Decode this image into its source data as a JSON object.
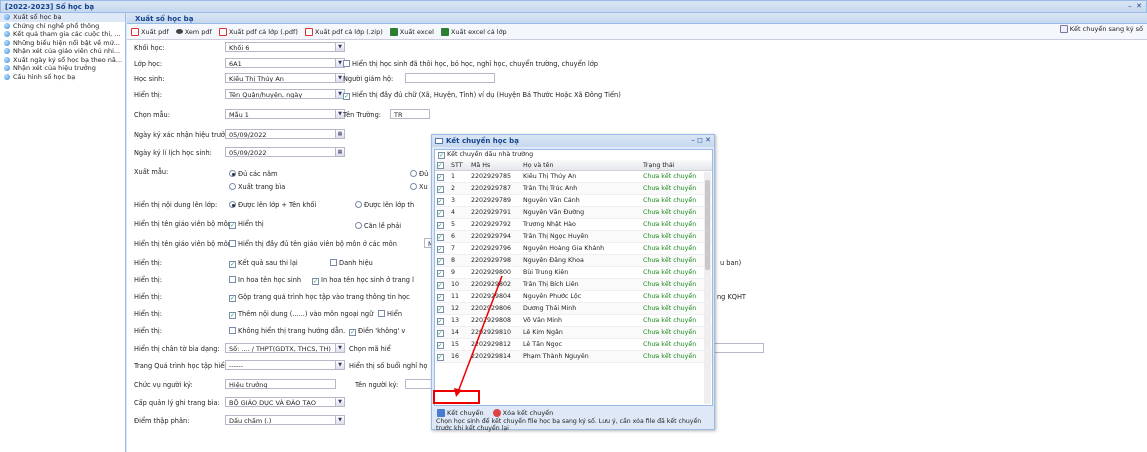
{
  "top_title": "[2022-2023] Sổ học bạ",
  "top_ctrls": "– ⁠ ✕",
  "tree": [
    "Xuất sổ học bạ",
    "Chứng chỉ nghề phổ thông",
    "Kết quả tham gia các cuộc thi, ...",
    "Những biểu hiện nổi bật về mứ...",
    "Nhận xét của giáo viên chủ nhi...",
    "Xuất ngày ký sổ học bạ theo nă...",
    "Nhận xét của hiệu trưởng",
    "Cấu hình sổ học bạ"
  ],
  "panel_title": "Xuất sổ học bạ",
  "toolbar": [
    "Xuất pdf",
    "Xem pdf",
    "Xuất pdf cả lớp (.pdf)",
    "Xuất pdf cả lớp (.zip)",
    "Xuất excel",
    "Xuất excel cả lớp"
  ],
  "toolbar_right": "Kết chuyển sang ký số",
  "form": {
    "khoi_label": "Khối học:",
    "khoi_val": "Khối 6",
    "lop_label": "Lớp học:",
    "lop_val": "6A1",
    "lop_cb": "Hiển thị học sinh đã thôi học, bỏ học, nghỉ học, chuyển trường, chuyển lớp",
    "hs_label": "Học sinh:",
    "hs_val": "Kiều Thị Thúy An",
    "gh_label": "Người giám hộ:",
    "ht_label": "Hiển thị:",
    "ht_val": "Tên Quận/huyện, ngày",
    "ht_cb": "Hiển thị đầy đủ chữ (Xã, Huyện, Tỉnh) ví dụ (Huyện Bá Thước Hoặc Xã Đông Tiến)",
    "mau_label": "Chọn mẫu:",
    "mau_val": "Mẫu 1",
    "tt_label": "Tên Trường:",
    "tt_val": "TR",
    "nky_label": "Ngày ký xác nhận hiệu trưởng:",
    "nky_val": "05/09/2022",
    "nll_label": "Ngày ký lí lịch học sinh:",
    "nll_val": "05/09/2022",
    "xm_label": "Xuất mẫu:",
    "xm_r1": "Đủ các năm",
    "xm_r2": "Xuất trang bìa",
    "xm_r3": "Đủ",
    "xm_r4": "Xu",
    "nd_label": "Hiển thị nội dung lên lớp:",
    "nd_r1": "Được lên lớp + Tên khối",
    "nd_r2": "Được lên lớp th",
    "gv_label": "Hiển thị tên giáo viên bộ môn:",
    "gv_cb": "Hiển thị",
    "gv_r": "Căn lề phải",
    "gvf_label": "Hiển thị tên giáo viên bộ môn:",
    "gvf_cb": "Hiển thị đầy đủ tên giáo viên bộ môn ở các môn",
    "gvf_val": "Mã",
    "h1_label": "Hiển thị:",
    "h1_cb": "Kết quả sau thi lại",
    "h1_cb2": "Danh hiệu",
    "h1_tail": "u ban)",
    "h2_label": "Hiển thị:",
    "h2_cb": "In hoa tên học sinh",
    "h2_cb2": "In hoa tên học sinh ở trang l",
    "h3_label": "Hiển thị:",
    "h3_cb": "Gộp trang quá trình học tập vào trang thông tin học",
    "h3_tail": "ng KQHT",
    "h4_label": "Hiển thị:",
    "h4_cb": "Thêm nội dung (......) vào môn ngoại ngữ",
    "h4_cb2": "Hiển",
    "h5_label": "Hiển thị:",
    "h5_cb": "Không hiển thị trang hướng dẫn.",
    "h5_cb2": "Điền 'không' v",
    "ct_label": "Hiển thị chân tờ bìa dạng:",
    "ct_val": "Số: .... / THPT(GDTX, THCS, TH)",
    "ct_label2": "Chọn mã hiể",
    "qt_label": "Trang Quá trình học tập hiển thị:",
    "qt_val": "------",
    "qt_label2": "Hiển thị số buổi nghỉ họ",
    "cv_label": "Chức vụ người ký:",
    "cv_val": "Hiệu trưởng",
    "tnk_label": "Tên người ký:",
    "cq_label": "Cấp quản lý ghi trang bìa:",
    "cq_val": "BỘ GIÁO DỤC VÀ ĐÀO TẠO",
    "dtp_label": "Điểm thập phân:",
    "dtp_val": "Dấu chấm (.)"
  },
  "win": {
    "title": "Kết chuyển học bạ",
    "ctrls": "– ◻ ✕",
    "top_cb": "Kết chuyển dấu nhà trường",
    "headers": [
      "STT",
      "Mã Hs",
      "Họ và tên",
      "Trạng thái"
    ],
    "rows": [
      [
        "1",
        "2202929785",
        "Kiều Thị Thúy An"
      ],
      [
        "2",
        "2202929787",
        "Trần Thị Trúc Anh"
      ],
      [
        "3",
        "2202929789",
        "Nguyễn Văn Cảnh"
      ],
      [
        "4",
        "2202929791",
        "Nguyễn Văn Đường"
      ],
      [
        "5",
        "2202929792",
        "Trương Nhật Hào"
      ],
      [
        "6",
        "2202929794",
        "Trần Thị Ngọc Huyền"
      ],
      [
        "7",
        "2202929796",
        "Nguyễn Hoàng Gia Khánh"
      ],
      [
        "8",
        "2202929798",
        "Nguyễn Đăng Khoa"
      ],
      [
        "9",
        "2202929800",
        "Bùi Trung Kiên"
      ],
      [
        "10",
        "2202929802",
        "Trần Thị Bích Liên"
      ],
      [
        "11",
        "2202929804",
        "Nguyễn Phước Lộc"
      ],
      [
        "12",
        "2202929806",
        "Dương Thái Minh"
      ],
      [
        "13",
        "2202929808",
        "Võ Văn Minh"
      ],
      [
        "14",
        "2202929810",
        "Lê Kim Ngân"
      ],
      [
        "15",
        "2202929812",
        "Lê Tấn Ngọc"
      ],
      [
        "16",
        "2202929814",
        "Phạm Thành Nguyên"
      ]
    ],
    "status": "Chưa kết chuyển",
    "btn1": "Kết chuyển",
    "btn2": "Xóa kết chuyển",
    "note": "Chọn học sinh để kết chuyển file học bạ sang ký số. Lưu ý, cần xóa file đã kết chuyển trước khi kết chuyển lại"
  }
}
